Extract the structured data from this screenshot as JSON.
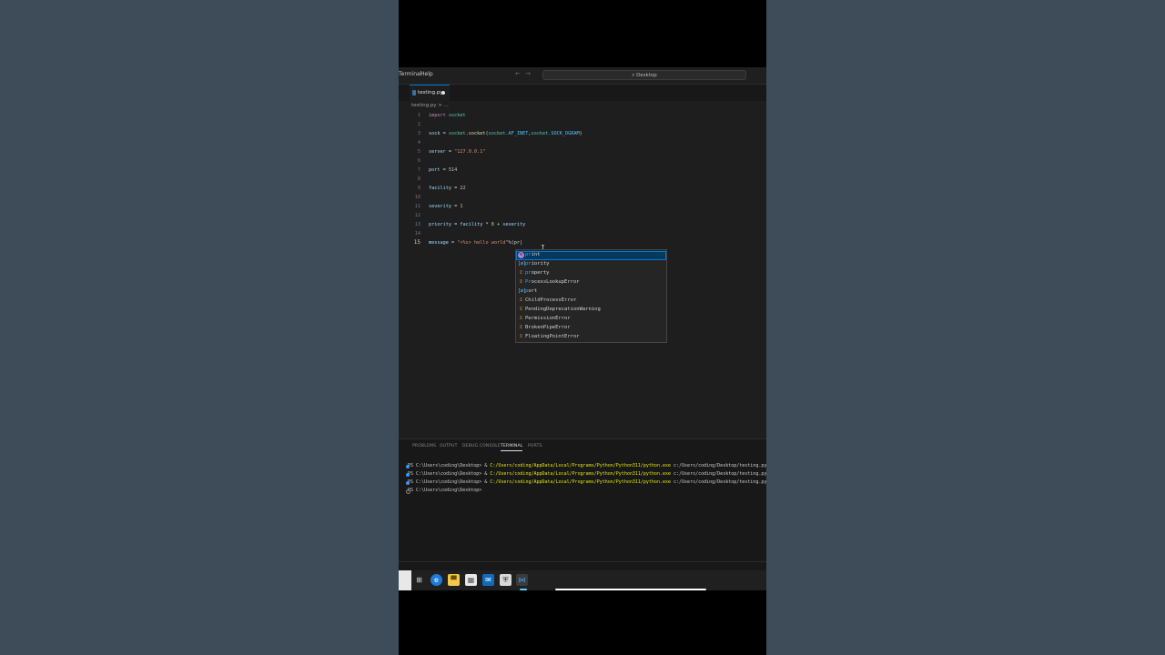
{
  "menu": {
    "terminal": "Terminal",
    "help": "Help"
  },
  "nav": {
    "back": "←",
    "forward": "→"
  },
  "search": {
    "label": "⌕ Desktop"
  },
  "tab": {
    "label": "testing.py"
  },
  "breadcrumb": "testing.py > ...",
  "code_lines": [
    {
      "n": "1"
    },
    {
      "n": "2"
    },
    {
      "n": "3"
    },
    {
      "n": "4"
    },
    {
      "n": "5"
    },
    {
      "n": "6"
    },
    {
      "n": "7"
    },
    {
      "n": "8"
    },
    {
      "n": "9"
    },
    {
      "n": "10"
    },
    {
      "n": "11"
    },
    {
      "n": "12"
    },
    {
      "n": "13"
    },
    {
      "n": "14"
    },
    {
      "n": "15"
    }
  ],
  "code": {
    "l1_kw": "import",
    "l1_mod": " socket",
    "l3_var": "sock",
    "l3_op": " = ",
    "l3_mod": "socket",
    "l3_rest": ".socket(",
    "l3_a1": "socket",
    "l3_a1b": ".AF_INET",
    "l3_comma": ",",
    "l3_a2": "socket",
    "l3_a2b": ".SOCK_DGRAM",
    "l3_close": ")",
    "l5_var": "server",
    "l5_op": " = ",
    "l5_str": "\"127.0.0.1\"",
    "l7_var": "port",
    "l7_op": " = ",
    "l7_num": "514",
    "l9_var": "facility",
    "l9_op": " = ",
    "l9_num": "22",
    "l11_var": "severity",
    "l11_op": " = ",
    "l11_num": "1",
    "l13_var": "priority",
    "l13_op": " = ",
    "l13_v1": "facility",
    "l13_op2": " * ",
    "l13_num": "8",
    "l13_op3": " + ",
    "l13_v2": "severity",
    "l15_var": "message",
    "l15_op": " = ",
    "l15_str": "\"<%s> hello world\"",
    "l15_op2": "%",
    "l15_typed": "(pr",
    "l15_cursor": "|"
  },
  "suggestions": [
    {
      "icon": "⊙",
      "type": "fn",
      "match": "pr",
      "rest": "int"
    },
    {
      "icon": "[ø]",
      "type": "var",
      "match": "pr",
      "rest": "iority"
    },
    {
      "icon": "☡",
      "type": "cls",
      "match": "pr",
      "rest": "operty"
    },
    {
      "icon": "☡",
      "type": "cls",
      "match": "Pr",
      "rest": "ocessLookupError"
    },
    {
      "icon": "[ø]",
      "type": "var",
      "match": "p",
      "rest": "ort"
    },
    {
      "icon": "☡",
      "type": "cls",
      "match": "",
      "rest": "ChildProcessError"
    },
    {
      "icon": "☡",
      "type": "cls",
      "match": "",
      "rest": "PendingDeprecationWarning"
    },
    {
      "icon": "☡",
      "type": "cls",
      "match": "",
      "rest": "PermissionError"
    },
    {
      "icon": "☡",
      "type": "cls",
      "match": "",
      "rest": "BrokenPipeError"
    },
    {
      "icon": "☡",
      "type": "cls",
      "match": "",
      "rest": "FloatingPointError"
    }
  ],
  "panel_tabs": [
    "PROBLEMS",
    "OUTPUT",
    "DEBUG CONSOLE",
    "TERMINAL",
    "PORTS"
  ],
  "terminal": [
    {
      "prompt": "PS C:\\Users\\coding\\Desktop> & ",
      "cmd": "C:/Users/coding/AppData/Local/Programs/Python/Python311/python.exe",
      "arg": " c:/Users/coding/Desktop/testing.py"
    },
    {
      "prompt": "PS C:\\Users\\coding\\Desktop> & ",
      "cmd": "C:/Users/coding/AppData/Local/Programs/Python/Python311/python.exe",
      "arg": " c:/Users/coding/Desktop/testing.py"
    },
    {
      "prompt": "PS C:\\Users\\coding\\Desktop> & ",
      "cmd": "C:/Users/coding/AppData/Local/Programs/Python/Python311/python.exe",
      "arg": " c:/Users/coding/Desktop/testing.py"
    },
    {
      "prompt": "PS C:\\Users\\coding\\Desktop>",
      "cmd": "",
      "arg": ""
    }
  ],
  "taskbar": {
    "icons": [
      "task-view-icon",
      "edge-icon",
      "file-explorer-icon",
      "store-icon",
      "mail-icon",
      "defender-icon",
      "vscode-icon"
    ]
  },
  "colors": {
    "accent": "#0078d4",
    "selection": "#04395e",
    "terminal_cmd": "#e5e510"
  }
}
